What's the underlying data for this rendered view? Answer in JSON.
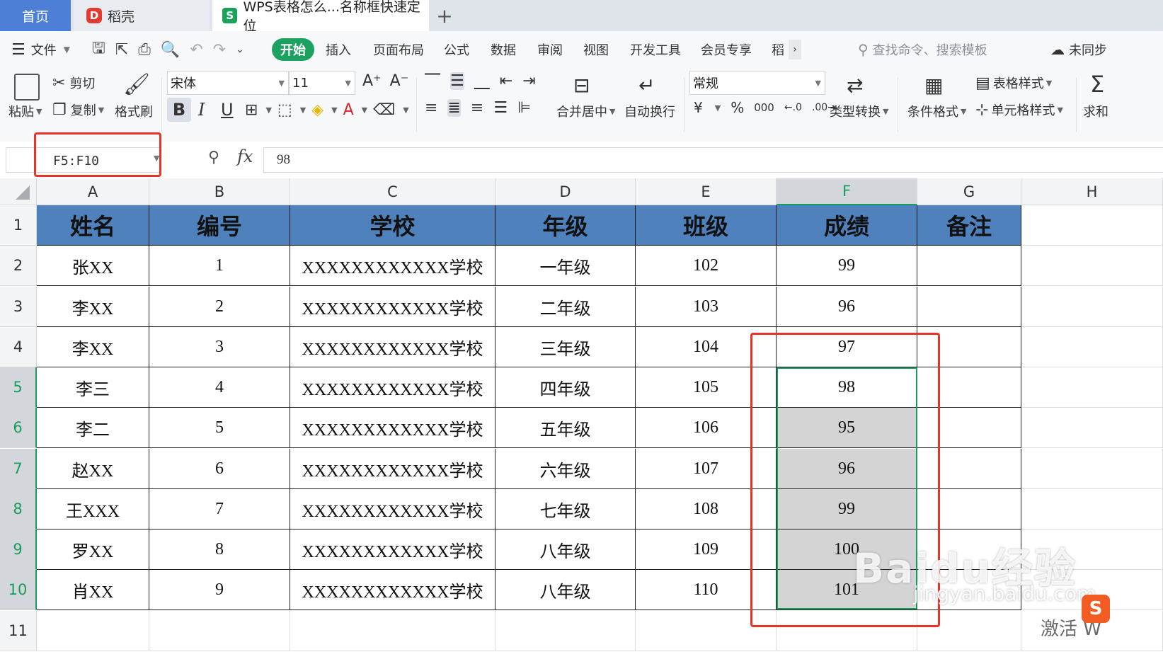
{
  "tabs": {
    "home": "首页",
    "daoke": "稻壳",
    "doc": "WPS表格怎么...名称框快速定位",
    "add": "+"
  },
  "menu": {
    "file": "文件",
    "items": [
      "开始",
      "插入",
      "页面布局",
      "公式",
      "数据",
      "审阅",
      "视图",
      "开发工具",
      "会员专享",
      "稻"
    ],
    "search_placeholder": "查找命令、搜索模板",
    "sync": "未同步"
  },
  "ribbon": {
    "paste": "粘贴",
    "cut": "剪切",
    "copy": "复制",
    "format_painter": "格式刷",
    "font_name": "宋体",
    "font_size": "11",
    "bold": "B",
    "italic": "I",
    "underline": "U",
    "merge_center": "合并居中",
    "wrap_text": "自动换行",
    "number_format": "常规",
    "type_convert": "类型转换",
    "cond_format": "条件格式",
    "table_style": "表格样式",
    "cell_style": "单元格样式",
    "sum": "求和"
  },
  "formula_bar": {
    "name_box": "F5:F10",
    "fx": "fx",
    "value": "98"
  },
  "grid": {
    "columns": [
      "A",
      "B",
      "C",
      "D",
      "E",
      "F",
      "G",
      "H"
    ],
    "rows": [
      "1",
      "2",
      "3",
      "4",
      "5",
      "6",
      "7",
      "8",
      "9",
      "10",
      "11"
    ],
    "header": [
      "姓名",
      "编号",
      "学校",
      "年级",
      "班级",
      "成绩",
      "备注"
    ],
    "data": [
      [
        "张XX",
        "1",
        "XXXXXXXXXXXX学校",
        "一年级",
        "102",
        "99",
        ""
      ],
      [
        "李XX",
        "2",
        "XXXXXXXXXXXX学校",
        "二年级",
        "103",
        "96",
        ""
      ],
      [
        "李XX",
        "3",
        "XXXXXXXXXXXX学校",
        "三年级",
        "104",
        "97",
        ""
      ],
      [
        "李三",
        "4",
        "XXXXXXXXXXXX学校",
        "四年级",
        "105",
        "98",
        ""
      ],
      [
        "李二",
        "5",
        "XXXXXXXXXXXX学校",
        "五年级",
        "106",
        "95",
        ""
      ],
      [
        "赵XX",
        "6",
        "XXXXXXXXXXXX学校",
        "六年级",
        "107",
        "96",
        ""
      ],
      [
        "王XXX",
        "7",
        "XXXXXXXXXXXX学校",
        "七年级",
        "108",
        "99",
        ""
      ],
      [
        "罗XX",
        "8",
        "XXXXXXXXXXXX学校",
        "八年级",
        "109",
        "100",
        ""
      ],
      [
        "肖XX",
        "9",
        "XXXXXXXXXXXX学校",
        "八年级",
        "110",
        "101",
        ""
      ]
    ],
    "selected_column": "F",
    "selected_rows": [
      "5",
      "6",
      "7",
      "8",
      "9",
      "10"
    ]
  },
  "watermark": {
    "brand": "Baidu经验",
    "url": "jingyan.baidu.com"
  },
  "overlay": {
    "activate": "激活 W",
    "ime": "S"
  },
  "colors": {
    "header_fill": "#4f81bd",
    "selection": "#1a9c5e",
    "annotation": "#e8332a",
    "start_tab": "#1da161"
  }
}
